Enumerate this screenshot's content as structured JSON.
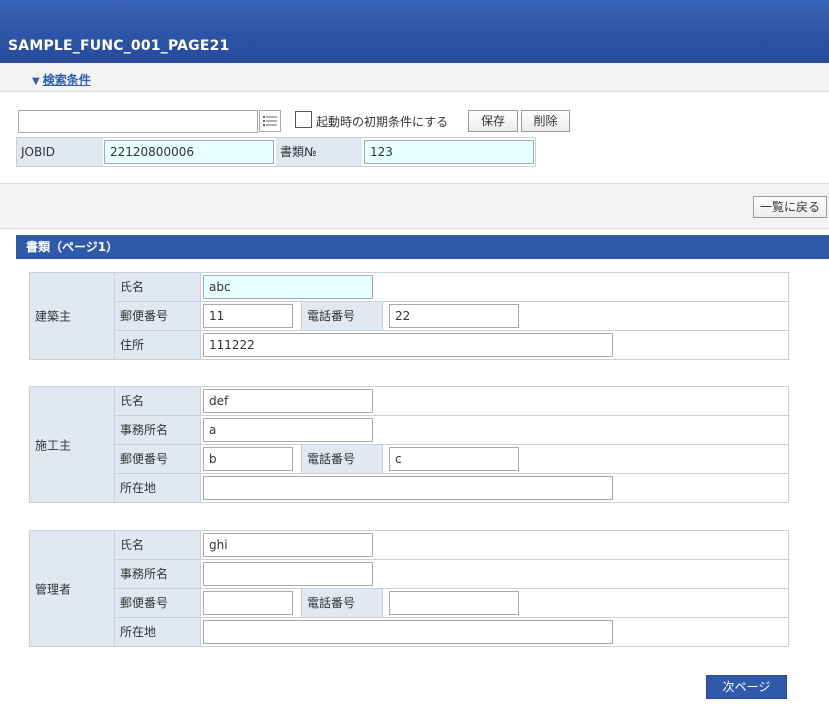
{
  "header": {
    "title": "SAMPLE_FUNC_001_PAGE21"
  },
  "conditions": {
    "toggle_label": "検索条件",
    "preset_value": "",
    "checkbox_label": "起動時の初期条件にする",
    "save_label": "保存",
    "delete_label": "削除",
    "jobid_label": "JOBID",
    "jobid_value": "22120800006",
    "docno_label": "書類№",
    "docno_value": "123"
  },
  "back_label": "一覧に戻る",
  "section_title": "書類（ページ1）",
  "groups": [
    {
      "label": "建築主",
      "name_label": "氏名",
      "name_value": "abc",
      "zip_label": "郵便番号",
      "zip_value": "11",
      "tel_label": "電話番号",
      "tel_value": "22",
      "addr_label": "住所",
      "addr_value": "111222"
    },
    {
      "label": "施工主",
      "name_label": "氏名",
      "name_value": "def",
      "office_label": "事務所名",
      "office_value": "a",
      "zip_label": "郵便番号",
      "zip_value": "b",
      "tel_label": "電話番号",
      "tel_value": "c",
      "addr_label": "所在地",
      "addr_value": ""
    },
    {
      "label": "管理者",
      "name_label": "氏名",
      "name_value": "ghi",
      "office_label": "事務所名",
      "office_value": "",
      "zip_label": "郵便番号",
      "zip_value": "",
      "tel_label": "電話番号",
      "tel_value": "",
      "addr_label": "所在地",
      "addr_value": ""
    }
  ],
  "next_label": "次ページ",
  "colors": {
    "header": "#2d54a6",
    "section": "#2f5aaa",
    "label_bg": "#e2e8f1",
    "highlight": "#e6ffff"
  }
}
